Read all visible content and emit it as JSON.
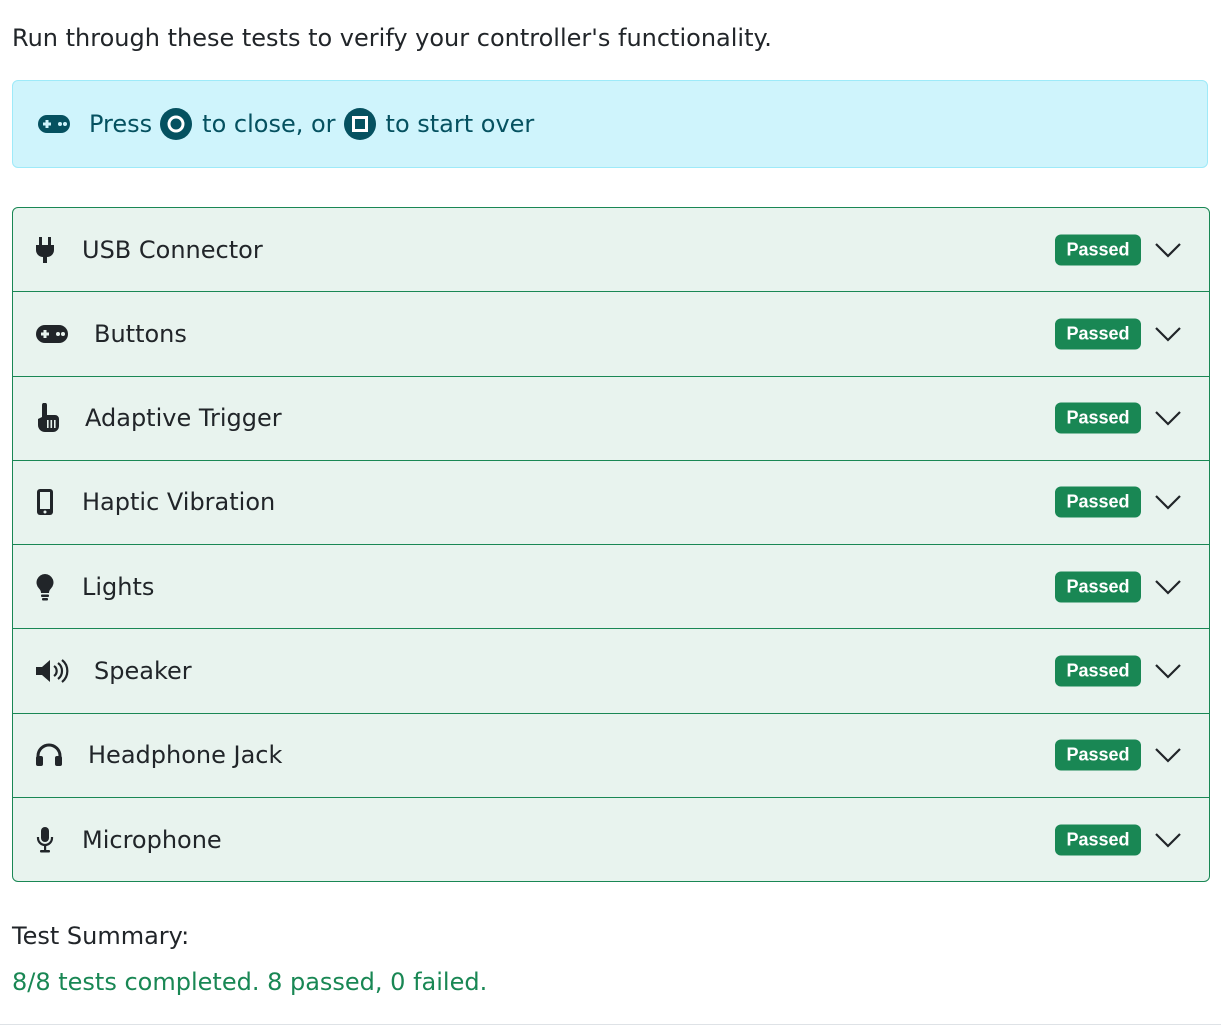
{
  "intro_text": "Run through these tests to verify your controller's functionality.",
  "notice": {
    "icon": "gamepad-icon",
    "press": "Press",
    "to_close": "to close, or",
    "to_start_over": "to start over",
    "close_button": "circle-button-icon",
    "restart_button": "square-button-icon"
  },
  "tests": [
    {
      "label": "USB Connector",
      "icon": "plug-icon",
      "status": "Passed"
    },
    {
      "label": "Buttons",
      "icon": "gamepad-icon",
      "status": "Passed"
    },
    {
      "label": "Adaptive Trigger",
      "icon": "hand-pointer-icon",
      "status": "Passed"
    },
    {
      "label": "Haptic Vibration",
      "icon": "phone-icon",
      "status": "Passed"
    },
    {
      "label": "Lights",
      "icon": "lightbulb-icon",
      "status": "Passed"
    },
    {
      "label": "Speaker",
      "icon": "volume-icon",
      "status": "Passed"
    },
    {
      "label": "Headphone Jack",
      "icon": "headphones-icon",
      "status": "Passed"
    },
    {
      "label": "Microphone",
      "icon": "microphone-icon",
      "status": "Passed"
    }
  ],
  "summary": {
    "title": "Test Summary:",
    "text": "8/8 tests completed. 8 passed, 0 failed."
  },
  "colors": {
    "success": "#198754",
    "info_bg": "#cff4fc",
    "info_text": "#055160",
    "row_bg": "#e8f3ee"
  }
}
